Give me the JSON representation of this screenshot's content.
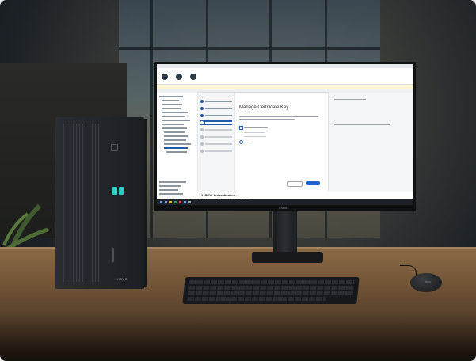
{
  "scene": {
    "description_tags": [
      "desktop-tower",
      "monitor",
      "keyboard",
      "mouse",
      "desk",
      "window"
    ],
    "brand_on_monitor": "/ISUS",
    "brand_on_tower": "/ISUS",
    "brand_on_mouse": "/ISUS"
  },
  "screen": {
    "wizard_title": "Manage Certificate Key",
    "section_heading": "2. BIOS Authentication",
    "section_sub": "Set Administrator Password to Enhance Device Protection"
  },
  "colors": {
    "accent": "#1d63c9",
    "usb": "#2ccfc4"
  }
}
